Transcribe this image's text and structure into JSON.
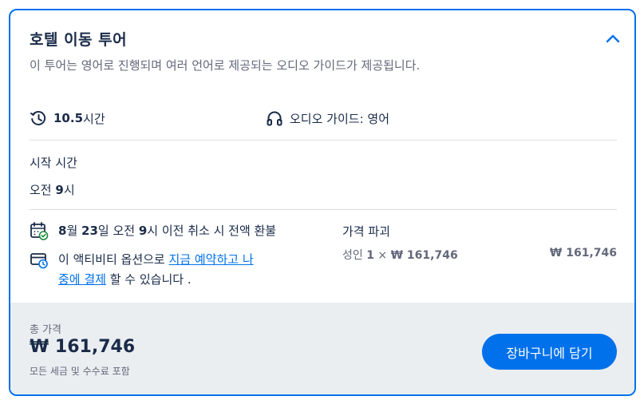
{
  "title": "호텔 이동 투어",
  "description": "이 투어는 영어로 진행되며 여러 언어로 제공되는 오디오 가이드가 제공됩니다.",
  "duration": {
    "number": "10.5",
    "unit": "시간",
    "icon": "clock-history-icon"
  },
  "audio_guide": {
    "label": "오디오 가이드: 영어",
    "icon": "headphones-icon"
  },
  "start_time": {
    "label": "시작 시간",
    "value_prefix": "오전 ",
    "value_number": "9",
    "value_suffix": "시"
  },
  "cancellation": {
    "icon": "calendar-check-icon",
    "month": "8",
    "month_unit": "월 ",
    "day": "23",
    "day_unit": "일 오전 ",
    "hour": "9",
    "rest": "시 이전 취소 시 전액 환불"
  },
  "reserve_later": {
    "icon": "card-clock-icon",
    "prefix": "이 액티비티 옵션으로 ",
    "link_line1": "지금 예약하고 나",
    "link_line2": "중에 결제",
    "suffix": " 할 수 있습니다 ."
  },
  "price_breakdown": {
    "heading": "가격 파괴",
    "line_label": "성인 ",
    "line_qty": "1",
    "line_times": " × ",
    "line_unit_price": "₩ 161,746",
    "line_amount": "₩ 161,746"
  },
  "footer": {
    "total_label": "총 가격",
    "total_value": "₩ 161,746",
    "note": "모든 세금 및 수수료 포함",
    "cart_button": "장바구니에 담기"
  },
  "colors": {
    "accent": "#0071eb",
    "text": "#1a2b49",
    "muted": "#63687a",
    "footer_bg": "#ebeef1"
  }
}
